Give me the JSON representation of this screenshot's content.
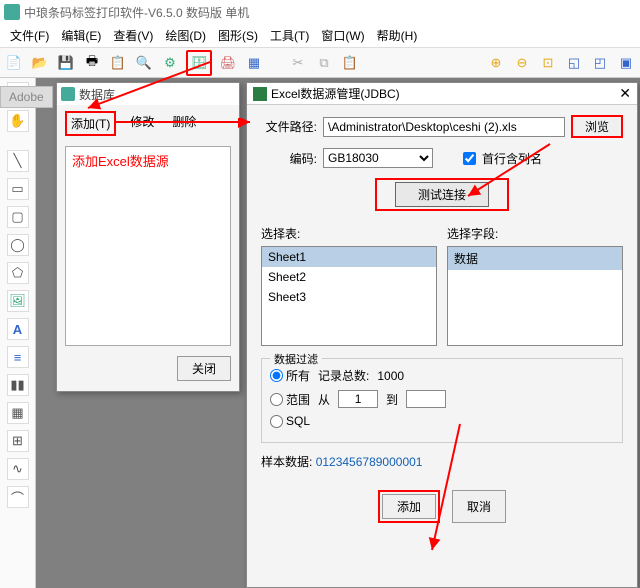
{
  "app": {
    "title": "中琅条码标签打印软件-V6.5.0 数码版 单机"
  },
  "menu": {
    "file": "文件(F)",
    "edit": "编辑(E)",
    "view": "查看(V)",
    "draw": "绘图(D)",
    "shape": "图形(S)",
    "tool": "工具(T)",
    "window": "窗口(W)",
    "help": "帮助(H)"
  },
  "adobe": "Adobe",
  "dlg1": {
    "title": "数据库",
    "add": "添加(T)",
    "modify": "修改",
    "delete": "删除",
    "red_hint": "添加Excel数据源",
    "close": "关闭"
  },
  "dlg2": {
    "title": "Excel数据源管理(JDBC)",
    "path_label": "文件路径:",
    "path_value": "\\Administrator\\Desktop\\ceshi (2).xls",
    "browse": "浏览",
    "enc_label": "编码:",
    "enc_value": "GB18030",
    "first_row": "首行含列名",
    "test": "测试连接",
    "sel_table": "选择表:",
    "sel_field": "选择字段:",
    "tables": [
      "Sheet1",
      "Sheet2",
      "Sheet3"
    ],
    "fields": [
      "数据"
    ],
    "filter_legend": "数据过滤",
    "filt_all": "所有",
    "filt_count_label": "记录总数:",
    "filt_count": "1000",
    "filt_range": "范围",
    "filt_from": "从",
    "filt_from_v": "1",
    "filt_to": "到",
    "filt_to_v": "",
    "filt_sql": "SQL",
    "sample_label": "样本数据:",
    "sample_value": "0123456789000001",
    "add": "添加",
    "cancel": "取消"
  }
}
